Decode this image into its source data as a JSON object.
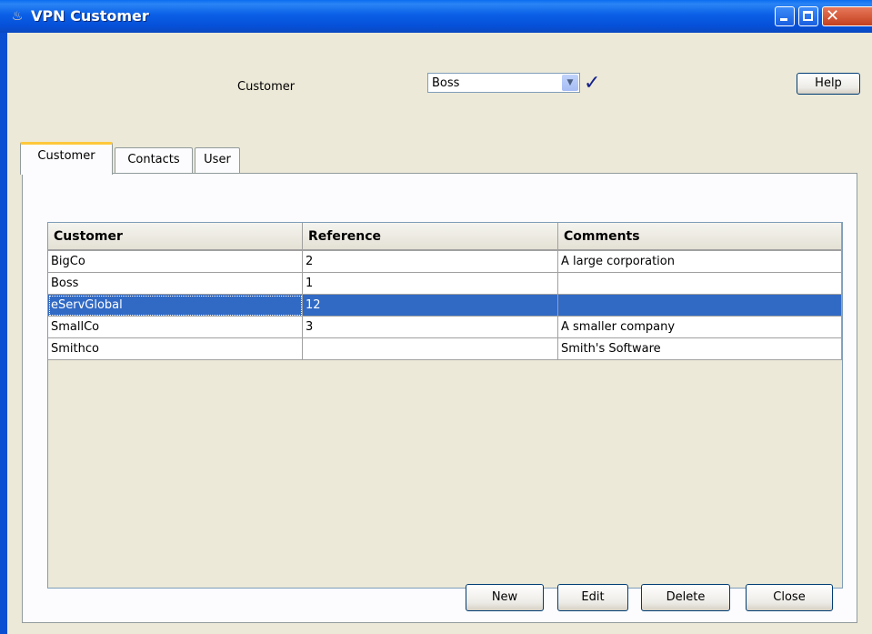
{
  "window": {
    "title": "VPN Customer"
  },
  "header": {
    "customer_label": "Customer",
    "customer_select_value": "Boss",
    "help_label": "Help"
  },
  "tabs": [
    {
      "label": "Customer",
      "active": true
    },
    {
      "label": "Contacts",
      "active": false
    },
    {
      "label": "User",
      "active": false
    }
  ],
  "table": {
    "columns": [
      "Customer",
      "Reference",
      "Comments"
    ],
    "rows": [
      {
        "customer": "BigCo",
        "reference": "2",
        "comments": "A large corporation",
        "selected": false
      },
      {
        "customer": "Boss",
        "reference": "1",
        "comments": "",
        "selected": false
      },
      {
        "customer": "eServGlobal",
        "reference": "12",
        "comments": "",
        "selected": true
      },
      {
        "customer": "SmallCo",
        "reference": "3",
        "comments": "A smaller company",
        "selected": false
      },
      {
        "customer": "Smithco",
        "reference": "",
        "comments": "Smith's Software",
        "selected": false
      }
    ]
  },
  "buttons": {
    "new_label": "New",
    "edit_label": "Edit",
    "delete_label": "Delete",
    "close_label": "Close"
  },
  "icons": {
    "app": "java-cup-icon",
    "confirm": "checkmark-icon",
    "dropdown": "chevron-down-icon"
  },
  "colors": {
    "titlebar": "#0a5fe6",
    "selection": "#316ac5",
    "active_tab_accent": "#ffc83c"
  }
}
